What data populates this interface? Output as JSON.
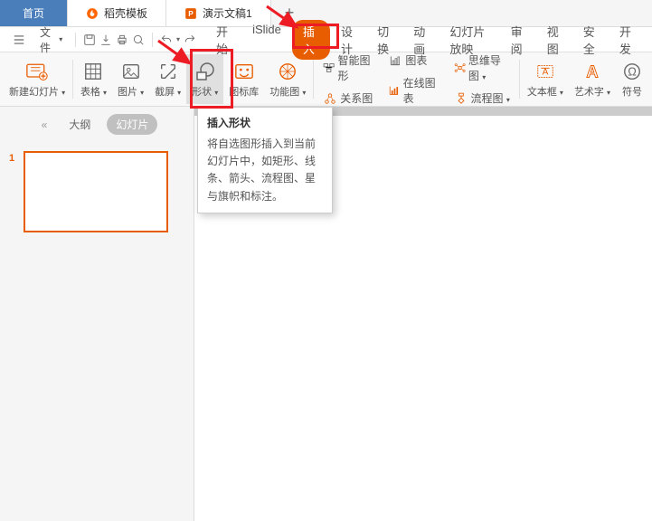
{
  "tabs": {
    "home": "首页",
    "template": "稻壳模板",
    "doc": "演示文稿1",
    "plus": "+"
  },
  "filemenu": {
    "label": "文件"
  },
  "ribbon_tabs": {
    "start": "开始",
    "islide": "iSlide",
    "insert": "插入",
    "design": "设计",
    "transition": "切换",
    "animation": "动画",
    "slideshow": "幻灯片放映",
    "review": "审阅",
    "view": "视图",
    "security": "安全",
    "dev": "开发"
  },
  "ribbon": {
    "newslide": "新建幻灯片",
    "table": "表格",
    "picture": "图片",
    "screenshot": "截屏",
    "shapes": "形状",
    "iconlib": "图标库",
    "functiongraph": "功能图",
    "smartart": "智能图形",
    "chart": "图表",
    "relationship": "关系图",
    "onlinechart": "在线图表",
    "mindmap": "思维导图",
    "flowchart": "流程图",
    "textbox": "文本框",
    "wordart": "艺术字",
    "symbol": "符号"
  },
  "tooltip": {
    "title": "插入形状",
    "body": "将自选图形插入到当前幻灯片中，如矩形、线条、箭头、流程图、星与旗帜和标注。"
  },
  "sidebar": {
    "collapse": "«",
    "outline": "大纲",
    "slides": "幻灯片",
    "slide1_num": "1"
  }
}
